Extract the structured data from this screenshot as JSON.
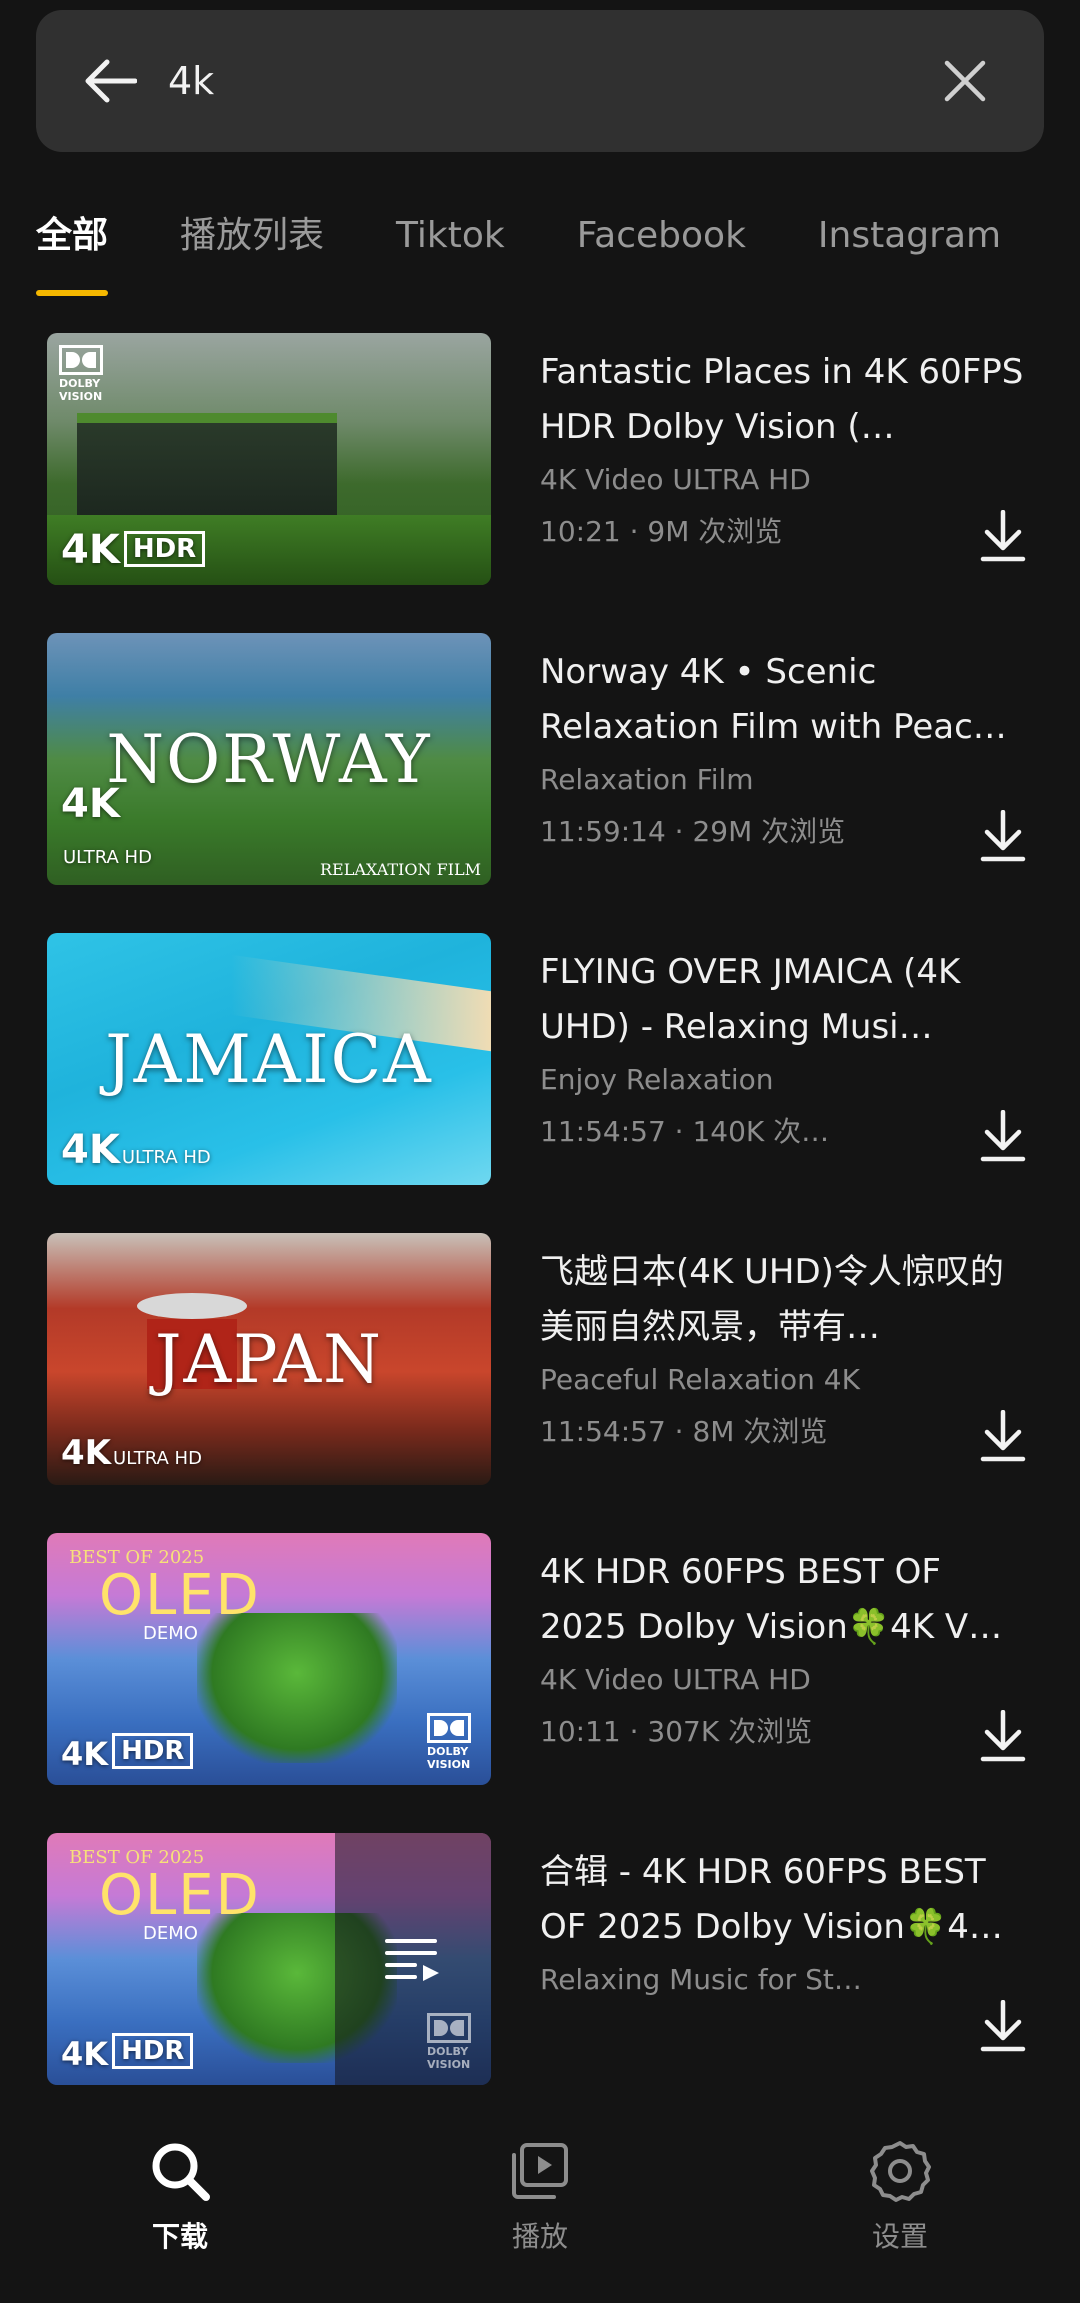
{
  "search": {
    "query": "4k"
  },
  "tabs": [
    {
      "label": "全部",
      "active": true
    },
    {
      "label": "播放列表",
      "active": false
    },
    {
      "label": "Tiktok",
      "active": false
    },
    {
      "label": "Facebook",
      "active": false
    },
    {
      "label": "Instagram",
      "active": false
    }
  ],
  "videos": [
    {
      "title": "Fantastic Places in 4K 60FPS HDR Dolby Vision (…",
      "channel": "4K Video ULTRA HD",
      "meta": "10:21 · 9M 次浏览"
    },
    {
      "title": "Norway 4K • Scenic Relaxation Film with Peac…",
      "channel": "Relaxation Film",
      "meta": "11:59:14 · 29M 次浏览",
      "thumb_text": "NORWAY",
      "thumb_sub": "RELAXATION FILM"
    },
    {
      "title": "FLYING OVER JMAICA (4K UHD) - Relaxing Musi…",
      "channel": "Enjoy Relaxation",
      "meta": "11:54:57 · 140K 次…",
      "thumb_text": "JAMAICA"
    },
    {
      "title": "飞越日本(4K UHD)令人惊叹的美丽自然风景，带有…",
      "channel": "Peaceful Relaxation 4K",
      "meta": "11:54:57 · 8M 次浏览",
      "thumb_text": "JAPAN"
    },
    {
      "title": "4K HDR 60FPS BEST OF 2025 Dolby Vision🍀4K V…",
      "channel": "4K Video ULTRA HD",
      "meta": "10:11 · 307K 次浏览",
      "thumb_text": "OLED",
      "thumb_top": "BEST OF 2025",
      "thumb_sub": "DEMO"
    },
    {
      "title": "合辑 - 4K HDR 60FPS BEST OF 2025 Dolby Vision🍀4…",
      "channel": "Relaxing Music for St…",
      "meta": "",
      "thumb_text": "OLED",
      "thumb_top": "BEST OF 2025",
      "thumb_sub": "DEMO"
    }
  ],
  "thumb_badges": {
    "fourk": "4K",
    "hdr": "HDR",
    "ultra_hd": "ULTRA HD",
    "dolby": "DOLBY VISION"
  },
  "nav": [
    {
      "label": "下载",
      "icon": "search-icon",
      "active": true
    },
    {
      "label": "播放",
      "icon": "play-library-icon",
      "active": false
    },
    {
      "label": "设置",
      "icon": "gear-icon",
      "active": false
    }
  ],
  "colors": {
    "accent": "#f5b800",
    "background": "#141414",
    "searchbar": "#303030"
  }
}
